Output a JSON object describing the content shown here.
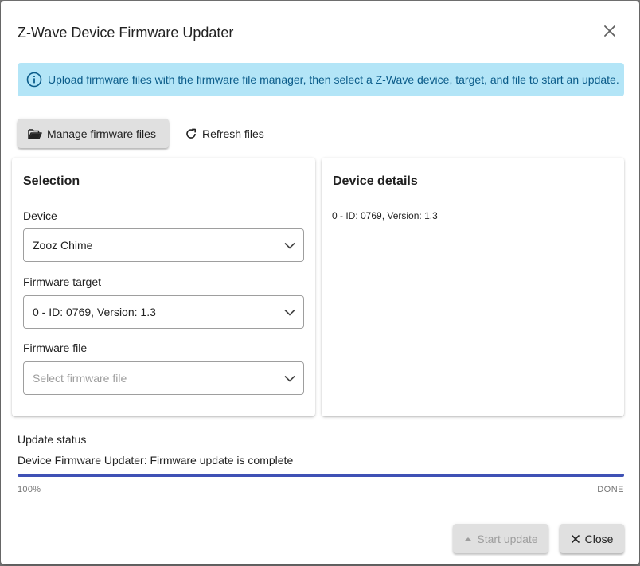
{
  "dialog": {
    "title": "Z-Wave Device Firmware Updater",
    "close_icon": "close-icon"
  },
  "info": {
    "icon": "info-icon",
    "text": "Upload firmware files with the firmware file manager, then select a Z-Wave device, target, and file to start an update.",
    "background_color": "#b3e5f7",
    "text_color": "#0b5c8a"
  },
  "toolbar": {
    "manage_label": "Manage firmware files",
    "manage_icon": "folder-open-icon",
    "refresh_label": "Refresh files",
    "refresh_icon": "refresh-icon"
  },
  "selection": {
    "title": "Selection",
    "device_label": "Device",
    "device_value": "Zooz Chime",
    "target_label": "Firmware target",
    "target_value": "0 - ID: 0769, Version: 1.3",
    "file_label": "Firmware file",
    "file_placeholder": "Select firmware file"
  },
  "details": {
    "title": "Device details",
    "text": "0 - ID: 0769, Version: 1.3"
  },
  "status": {
    "label": "Update status",
    "message": "Device Firmware Updater: Firmware update is complete",
    "progress_percent": 100,
    "progress_text": "100%",
    "state_text": "DONE",
    "progress_color": "#3f51b5"
  },
  "actions": {
    "start_label": "Start update",
    "start_icon": "upload-arrow-icon",
    "start_disabled": true,
    "close_label": "Close",
    "close_icon": "close-icon"
  }
}
